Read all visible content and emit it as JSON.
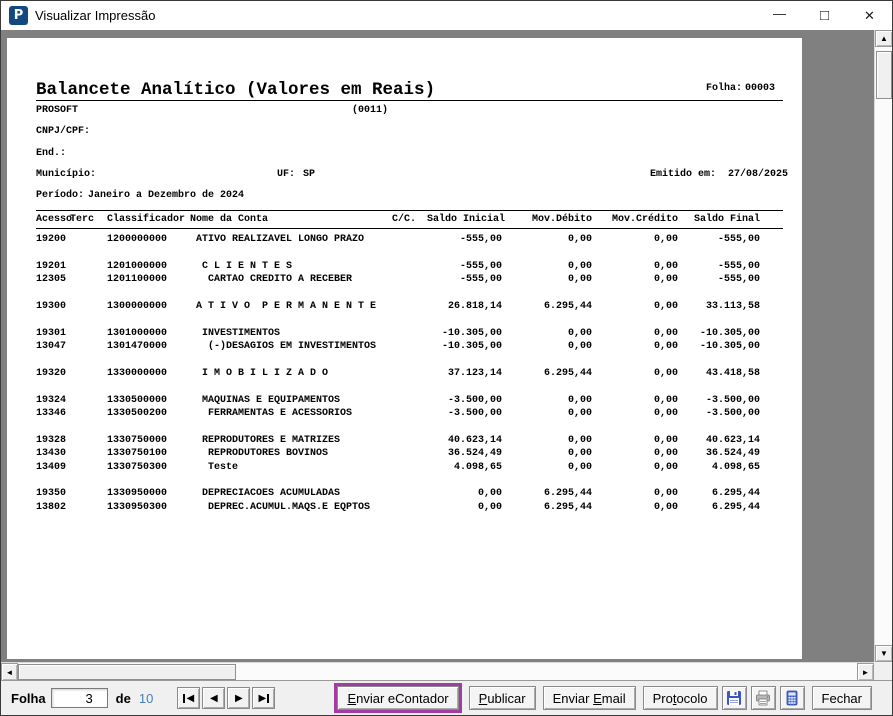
{
  "window": {
    "title": "Visualizar Impressão",
    "icon_letter": "P"
  },
  "icons": {
    "minimize": "—",
    "maximize": "□",
    "close": "✕",
    "nav_prev": "◀",
    "nav_next": "▶",
    "scroll_up": "▲",
    "scroll_down": "▼",
    "scroll_left": "◄",
    "scroll_right": "►",
    "save": "save-floppy-icon",
    "print": "printer-icon",
    "calc": "calculator-icon"
  },
  "colors": {
    "highlight": "#a23ba2",
    "total_pages": "#4a7ebf",
    "app_icon_bg": "#124a80",
    "canvas_gray": "#808080"
  },
  "report": {
    "title": "Balancete Analítico (Valores em Reais)",
    "folha_label": "Folha:",
    "folha_value": "00003",
    "company": "PROSOFT",
    "company_code": "(0011)",
    "cnpj_label": "CNPJ/CPF:",
    "end_label": "End.:",
    "municipio_label": "Município:",
    "uf_label": "UF:",
    "uf_value": "SP",
    "emitido_label": "Emitido em:",
    "emitido_value": "27/08/2025",
    "periodo_label": "Período:",
    "periodo_value": "Janeiro a Dezembro de 2024",
    "columns": {
      "acesso": "Acesso",
      "terc": "Terc",
      "classificador": "Classificador",
      "nome": "Nome da Conta",
      "cc": "C/C.",
      "saldo_inicial": "Saldo Inicial",
      "mov_debito": "Mov.Débito",
      "mov_credito": "Mov.Crédito",
      "saldo_final": "Saldo Final"
    },
    "rows": [
      {
        "gap": false,
        "acesso": "19200",
        "classificador": "1200000000",
        "nome": " ATIVO REALIZAVEL LONGO PRAZO",
        "saldo_inicial": "-555,00",
        "mov_debito": "0,00",
        "mov_credito": "0,00",
        "saldo_final": "-555,00"
      },
      {
        "gap": true,
        "acesso": "19201",
        "classificador": "1201000000",
        "nome": "  C L I E N T E S",
        "saldo_inicial": "-555,00",
        "mov_debito": "0,00",
        "mov_credito": "0,00",
        "saldo_final": "-555,00"
      },
      {
        "gap": false,
        "acesso": "12305",
        "classificador": "1201100000",
        "nome": "   CARTAO CREDITO A RECEBER",
        "saldo_inicial": "-555,00",
        "mov_debito": "0,00",
        "mov_credito": "0,00",
        "saldo_final": "-555,00"
      },
      {
        "gap": true,
        "acesso": "19300",
        "classificador": "1300000000",
        "nome": " A T I V O  P E R M A N E N T E",
        "saldo_inicial": "26.818,14",
        "mov_debito": "6.295,44",
        "mov_credito": "0,00",
        "saldo_final": "33.113,58"
      },
      {
        "gap": true,
        "acesso": "19301",
        "classificador": "1301000000",
        "nome": "  INVESTIMENTOS",
        "saldo_inicial": "-10.305,00",
        "mov_debito": "0,00",
        "mov_credito": "0,00",
        "saldo_final": "-10.305,00"
      },
      {
        "gap": false,
        "acesso": "13047",
        "classificador": "1301470000",
        "nome": "   (-)DESAGIOS EM INVESTIMENTOS",
        "saldo_inicial": "-10.305,00",
        "mov_debito": "0,00",
        "mov_credito": "0,00",
        "saldo_final": "-10.305,00"
      },
      {
        "gap": true,
        "acesso": "19320",
        "classificador": "1330000000",
        "nome": "  I M O B I L I Z A D O",
        "saldo_inicial": "37.123,14",
        "mov_debito": "6.295,44",
        "mov_credito": "0,00",
        "saldo_final": "43.418,58"
      },
      {
        "gap": true,
        "acesso": "19324",
        "classificador": "1330500000",
        "nome": "  MAQUINAS E EQUIPAMENTOS",
        "saldo_inicial": "-3.500,00",
        "mov_debito": "0,00",
        "mov_credito": "0,00",
        "saldo_final": "-3.500,00"
      },
      {
        "gap": false,
        "acesso": "13346",
        "classificador": "1330500200",
        "nome": "   FERRAMENTAS E ACESSORIOS",
        "saldo_inicial": "-3.500,00",
        "mov_debito": "0,00",
        "mov_credito": "0,00",
        "saldo_final": "-3.500,00"
      },
      {
        "gap": true,
        "acesso": "19328",
        "classificador": "1330750000",
        "nome": "  REPRODUTORES E MATRIZES",
        "saldo_inicial": "40.623,14",
        "mov_debito": "0,00",
        "mov_credito": "0,00",
        "saldo_final": "40.623,14"
      },
      {
        "gap": false,
        "acesso": "13430",
        "classificador": "1330750100",
        "nome": "   REPRODUTORES BOVINOS",
        "saldo_inicial": "36.524,49",
        "mov_debito": "0,00",
        "mov_credito": "0,00",
        "saldo_final": "36.524,49"
      },
      {
        "gap": false,
        "acesso": "13409",
        "classificador": "1330750300",
        "nome": "   Teste",
        "saldo_inicial": "4.098,65",
        "mov_debito": "0,00",
        "mov_credito": "0,00",
        "saldo_final": "4.098,65"
      },
      {
        "gap": true,
        "acesso": "19350",
        "classificador": "1330950000",
        "nome": "  DEPRECIACOES ACUMULADAS",
        "saldo_inicial": "0,00",
        "mov_debito": "6.295,44",
        "mov_credito": "0,00",
        "saldo_final": "6.295,44"
      },
      {
        "gap": false,
        "acesso": "13802",
        "classificador": "1330950300",
        "nome": "   DEPREC.ACUMUL.MAQS.E EQPTOS",
        "saldo_inicial": "0,00",
        "mov_debito": "6.295,44",
        "mov_credito": "0,00",
        "saldo_final": "6.295,44"
      }
    ]
  },
  "toolbar": {
    "folha_label": "Folha",
    "page_value": "3",
    "de_label": "de",
    "total_pages": "10",
    "buttons": {
      "enviar_econtador": {
        "pre": "",
        "key": "E",
        "post": "nviar eContador"
      },
      "publicar": {
        "pre": "",
        "key": "P",
        "post": "ublicar"
      },
      "enviar_email": {
        "pre": "Enviar ",
        "key": "E",
        "post": "mail"
      },
      "protocolo": {
        "pre": "Pro",
        "key": "t",
        "post": "ocolo"
      },
      "fechar": {
        "pre": "Fechar",
        "key": "",
        "post": ""
      }
    }
  }
}
